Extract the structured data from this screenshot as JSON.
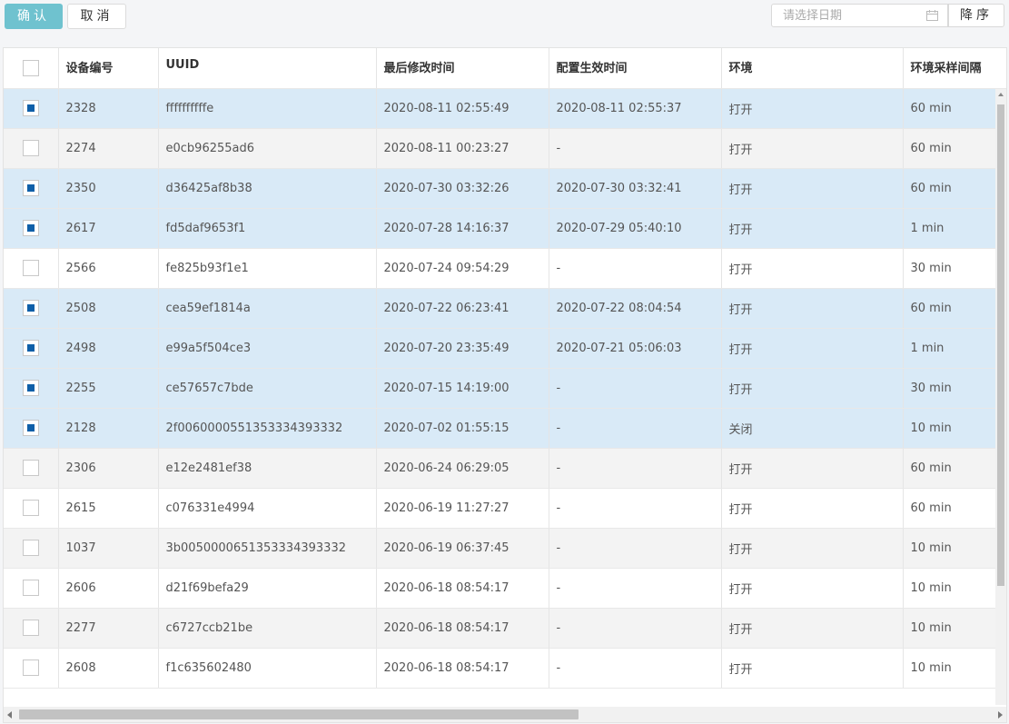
{
  "toolbar": {
    "confirm_label": "确认",
    "cancel_label": "取消",
    "date_placeholder": "请选择日期",
    "date_value": "",
    "sort_label": "降序"
  },
  "table": {
    "columns": [
      "设备编号",
      "UUID",
      "最后修改时间",
      "配置生效时间",
      "环境",
      "环境采样间隔"
    ],
    "rows": [
      {
        "id": "2328",
        "uuid": "ffffffffffe",
        "modified": "2020-08-11 02:55:49",
        "effective": "2020-08-11 02:55:37",
        "env": "打开",
        "interval": "60 min",
        "checked": true
      },
      {
        "id": "2274",
        "uuid": "e0cb96255ad6",
        "modified": "2020-08-11 00:23:27",
        "effective": "-",
        "env": "打开",
        "interval": "60 min",
        "checked": false
      },
      {
        "id": "2350",
        "uuid": "d36425af8b38",
        "modified": "2020-07-30 03:32:26",
        "effective": "2020-07-30 03:32:41",
        "env": "打开",
        "interval": "60 min",
        "checked": true
      },
      {
        "id": "2617",
        "uuid": "fd5daf9653f1",
        "modified": "2020-07-28 14:16:37",
        "effective": "2020-07-29 05:40:10",
        "env": "打开",
        "interval": "1 min",
        "checked": true
      },
      {
        "id": "2566",
        "uuid": "fe825b93f1e1",
        "modified": "2020-07-24 09:54:29",
        "effective": "-",
        "env": "打开",
        "interval": "30 min",
        "checked": false
      },
      {
        "id": "2508",
        "uuid": "cea59ef1814a",
        "modified": "2020-07-22 06:23:41",
        "effective": "2020-07-22 08:04:54",
        "env": "打开",
        "interval": "60 min",
        "checked": true
      },
      {
        "id": "2498",
        "uuid": "e99a5f504ce3",
        "modified": "2020-07-20 23:35:49",
        "effective": "2020-07-21 05:06:03",
        "env": "打开",
        "interval": "1 min",
        "checked": true
      },
      {
        "id": "2255",
        "uuid": "ce57657c7bde",
        "modified": "2020-07-15 14:19:00",
        "effective": "-",
        "env": "打开",
        "interval": "30 min",
        "checked": true
      },
      {
        "id": "2128",
        "uuid": "2f0060000551353334393332",
        "modified": "2020-07-02 01:55:15",
        "effective": "-",
        "env": "关闭",
        "interval": "10 min",
        "checked": true
      },
      {
        "id": "2306",
        "uuid": "e12e2481ef38",
        "modified": "2020-06-24 06:29:05",
        "effective": "-",
        "env": "打开",
        "interval": "60 min",
        "checked": false
      },
      {
        "id": "2615",
        "uuid": "c076331e4994",
        "modified": "2020-06-19 11:27:27",
        "effective": "-",
        "env": "打开",
        "interval": "60 min",
        "checked": false
      },
      {
        "id": "1037",
        "uuid": "3b0050000651353334393332",
        "modified": "2020-06-19 06:37:45",
        "effective": "-",
        "env": "打开",
        "interval": "10 min",
        "checked": false
      },
      {
        "id": "2606",
        "uuid": "d21f69befa29",
        "modified": "2020-06-18 08:54:17",
        "effective": "-",
        "env": "打开",
        "interval": "10 min",
        "checked": false
      },
      {
        "id": "2277",
        "uuid": "c6727ccb21be",
        "modified": "2020-06-18 08:54:17",
        "effective": "-",
        "env": "打开",
        "interval": "10 min",
        "checked": false
      },
      {
        "id": "2608",
        "uuid": "f1c635602480",
        "modified": "2020-06-18 08:54:17",
        "effective": "-",
        "env": "打开",
        "interval": "10 min",
        "checked": false
      }
    ]
  },
  "colors": {
    "confirm_bg": "#6fc2cf",
    "selected_row": "#d9eaf7",
    "checkbox_fill": "#0f5fa8"
  }
}
